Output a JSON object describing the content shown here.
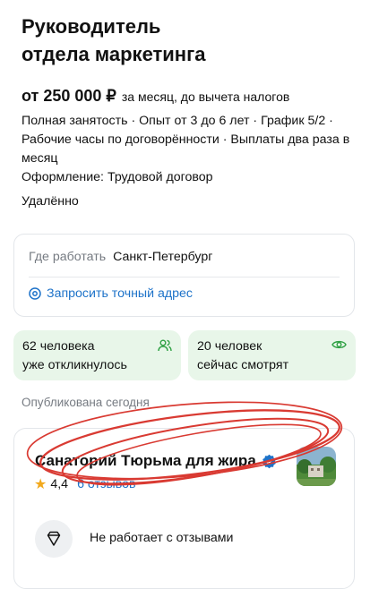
{
  "vacancy": {
    "title_line1": "Руководитель",
    "title_line2": "отдела маркетинга",
    "salary_amount": "от 250 000 ₽",
    "salary_note": "за месяц, до вычета налогов",
    "conditions": "Полная занятость · Опыт от 3 до 6 лет · График 5/2 · Рабочие часы по договорённости · Выплаты два раза в месяц",
    "employment": "Оформление: Трудовой договор",
    "work_format": "Удалённо"
  },
  "location": {
    "label": "Где работать",
    "city": "Санкт-Петербург",
    "request_address": "Запросить точный адрес"
  },
  "stats": {
    "responded_count": "62 человека",
    "responded_text": "уже откликнулось",
    "watching_count": "20 человек",
    "watching_text": "сейчас смотрят"
  },
  "published": "Опубликована сегодня",
  "company": {
    "name": "Санаторий Тюрьма для жира",
    "rating": "4,4",
    "reviews": "6 отзывов",
    "reviews_note": "Не работает с отзывами"
  },
  "icons": {
    "verified": "verified-badge-icon",
    "location": "location-pin-icon",
    "people": "people-icon",
    "eye": "eye-icon",
    "star": "star-icon",
    "no_reviews": "no-reviews-icon"
  },
  "colors": {
    "accent_link": "#1e73c9",
    "stat_bg": "#e8f6e9",
    "stat_icon": "#2ea043",
    "star": "#f2a91d",
    "scribble": "#d93a32"
  }
}
